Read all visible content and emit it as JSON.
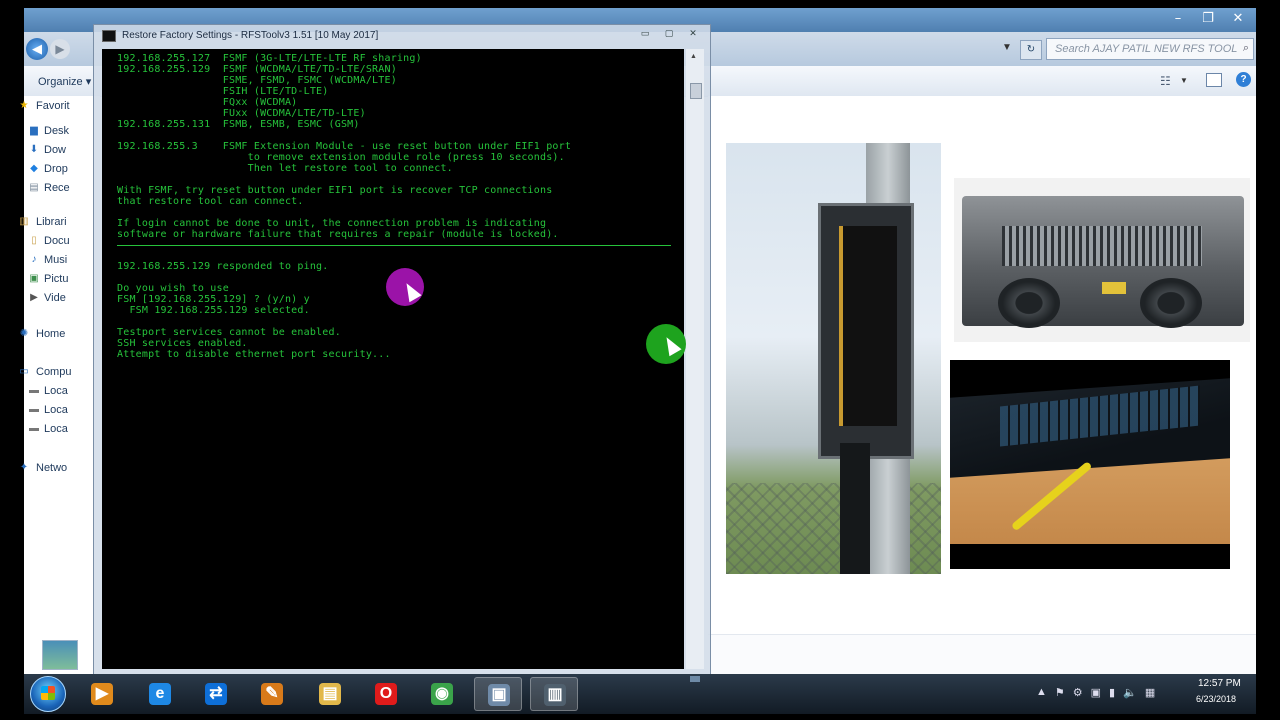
{
  "explorer": {
    "search_placeholder": "Search AJAY PATIL NEW RFS TOOL",
    "organize_label": "Organize",
    "organize_chevron": "▾",
    "back_glyph": "◀",
    "forward_glyph": "▶",
    "minimize_glyph": "–",
    "maximize_glyph": "❐",
    "close_glyph": "✕",
    "nav_items": [
      {
        "label": "Favorit",
        "icon": "star-icon",
        "glyph": "★",
        "color": "#e8b400"
      },
      {
        "label": "Desk",
        "icon": "desktop-icon",
        "glyph": "▆",
        "color": "#2a6fbf"
      },
      {
        "label": "Dow",
        "icon": "downloads-icon",
        "glyph": "⬇",
        "color": "#2a6fbf"
      },
      {
        "label": "Drop",
        "icon": "dropbox-icon",
        "glyph": "◆",
        "color": "#1f7fe0"
      },
      {
        "label": "Rece",
        "icon": "recent-icon",
        "glyph": "▤",
        "color": "#7a8a9a"
      },
      {
        "label": "Librari",
        "icon": "libraries-icon",
        "glyph": "▥",
        "color": "#c9a04c"
      },
      {
        "label": "Docu",
        "icon": "documents-icon",
        "glyph": "▯",
        "color": "#c9a04c"
      },
      {
        "label": "Musi",
        "icon": "music-icon",
        "glyph": "♪",
        "color": "#2a6fbf"
      },
      {
        "label": "Pictu",
        "icon": "pictures-icon",
        "glyph": "▣",
        "color": "#3d8e4c"
      },
      {
        "label": "Vide",
        "icon": "videos-icon",
        "glyph": "▶",
        "color": "#555"
      },
      {
        "label": "Home",
        "icon": "homegroup-icon",
        "glyph": "✺",
        "color": "#2a6fbf"
      },
      {
        "label": "Compu",
        "icon": "computer-icon",
        "glyph": "▭",
        "color": "#2a6fbf"
      },
      {
        "label": "Loca",
        "icon": "drive-icon",
        "glyph": "▬",
        "color": "#777"
      },
      {
        "label": "Loca",
        "icon": "drive-icon",
        "glyph": "▬",
        "color": "#777"
      },
      {
        "label": "Loca",
        "icon": "drive-icon",
        "glyph": "▬",
        "color": "#777"
      },
      {
        "label": "Netwo",
        "icon": "network-icon",
        "glyph": "✦",
        "color": "#2a6fbf"
      }
    ]
  },
  "console": {
    "title": "Restore Factory Settings - RFSToolv3 1.51 [10 May 2017]",
    "lines": [
      "192.168.255.127  FSMF (3G-LTE/LTE-LTE RF sharing)",
      "192.168.255.129  FSMF (WCDMA/LTE/TD-LTE/SRAN)",
      "                 FSME, FSMD, FSMC (WCDMA/LTE)",
      "                 FSIH (LTE/TD-LTE)",
      "                 FQxx (WCDMA)",
      "                 FUxx (WCDMA/LTE/TD-LTE)",
      "192.168.255.131  FSMB, ESMB, ESMC (GSM)",
      "",
      "192.168.255.3    FSMF Extension Module - use reset button under EIF1 port",
      "                     to remove extension module role (press 10 seconds).",
      "                     Then let restore tool to connect.",
      "",
      "With FSMF, try reset button under EIF1 port is recover TCP connections",
      "that restore tool can connect.",
      "",
      "If login cannot be done to unit, the connection problem is indicating",
      "software or hardware failure that requires a repair (module is locked).",
      "",
      "",
      "192.168.255.129 responded to ping.",
      "",
      "Do you wish to use",
      "FSM [192.168.255.129] ? (y/n) y",
      "  FSM 192.168.255.129 selected.",
      "",
      "Testport services cannot be enabled.",
      "SSH services enabled.",
      "Attempt to disable ethernet port security..."
    ]
  },
  "taskbar": {
    "clock_time": "12:57 PM",
    "clock_date": "6/23/2018",
    "apps": [
      {
        "name": "media-player-icon",
        "glyph": "▶",
        "color": "#e08a1c"
      },
      {
        "name": "internet-explorer-icon",
        "glyph": "e",
        "color": "#1e88e5"
      },
      {
        "name": "teamviewer-icon",
        "glyph": "⇄",
        "color": "#0e6fd8"
      },
      {
        "name": "paint-app-icon",
        "glyph": "✎",
        "color": "#d87a1a"
      },
      {
        "name": "file-explorer-icon",
        "glyph": "▤",
        "color": "#e2b84a"
      },
      {
        "name": "opera-icon",
        "glyph": "O",
        "color": "#e01b1b"
      },
      {
        "name": "chrome-icon",
        "glyph": "◉",
        "color": "#3aa34a"
      },
      {
        "name": "remote-desktop-icon",
        "glyph": "▣",
        "color": "#6f8aa8"
      },
      {
        "name": "console-app-icon",
        "glyph": "▥",
        "color": "#50606e"
      }
    ],
    "tray_icons": [
      "▲",
      "⚑",
      "⚙",
      "▣",
      "▮",
      "🔈",
      "▦"
    ]
  }
}
